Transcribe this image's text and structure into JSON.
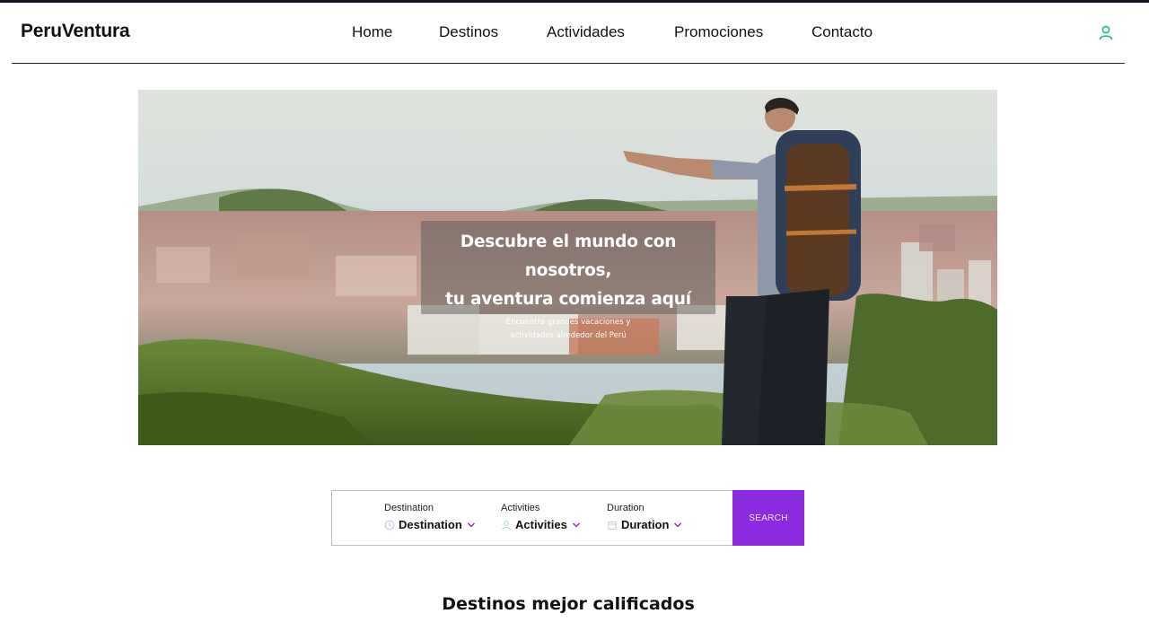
{
  "brand": {
    "name": "PeruVentura"
  },
  "nav": {
    "links": [
      {
        "label": "Home"
      },
      {
        "label": "Destinos"
      },
      {
        "label": "Actividades"
      },
      {
        "label": "Promociones"
      },
      {
        "label": "Contacto"
      }
    ],
    "user_icon": "user-icon"
  },
  "hero": {
    "title_line1": "Descubre el mundo con nosotros,",
    "title_line2": "tu aventura comienza aquí",
    "subtitle_line1": "Encuentra grandes vacaciones y",
    "subtitle_line2": "actividades alrededor del Perú"
  },
  "search": {
    "destination": {
      "label": "Destination",
      "value": "Destination",
      "icon": "clock-icon"
    },
    "activities": {
      "label": "Activities",
      "value": "Activities",
      "icon": "person-icon"
    },
    "duration": {
      "label": "Duration",
      "value": "Duration",
      "icon": "calendar-icon"
    },
    "button_label": "SEARCH"
  },
  "sections": {
    "top_destinations_title": "Destinos mejor calificados"
  },
  "colors": {
    "accent_purple": "#8a2be2",
    "user_icon_teal": "#1fb58f",
    "chevron_purple": "#8a2be2"
  }
}
